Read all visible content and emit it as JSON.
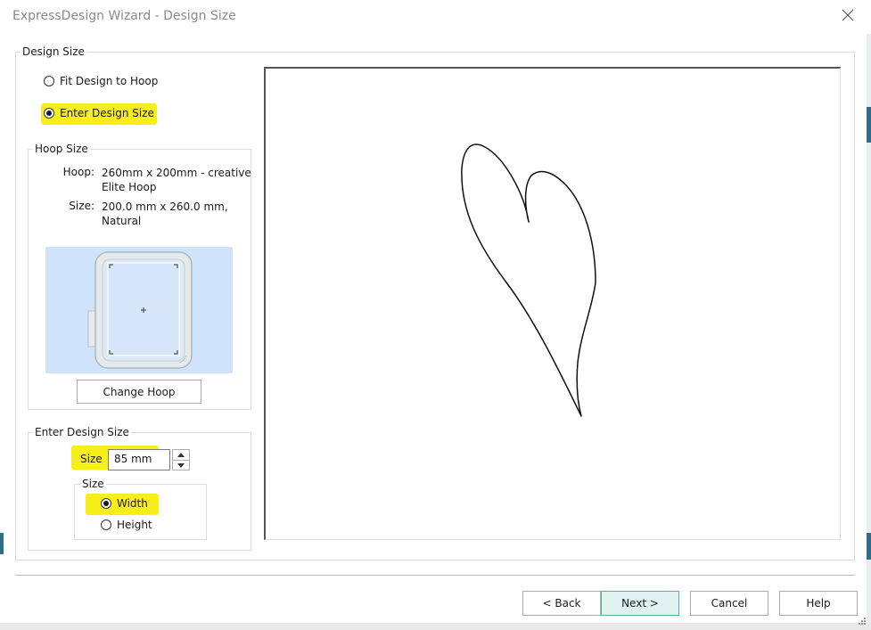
{
  "window": {
    "title": "ExpressDesign Wizard - Design Size",
    "close_icon": "close-icon"
  },
  "design_size_group": {
    "legend": "Design Size",
    "options": [
      {
        "label": "Fit Design to Hoop",
        "selected": false
      },
      {
        "label": "Enter Design Size",
        "selected": true
      }
    ]
  },
  "hoop_size": {
    "legend": "Hoop Size",
    "hoop_label": "Hoop:",
    "hoop_value": "260mm x 200mm - creative Elite Hoop",
    "size_label": "Size:",
    "size_value": "200.0 mm x 260.0 mm, Natural",
    "change_button": "Change Hoop"
  },
  "enter_design_size": {
    "legend": "Enter Design Size",
    "size_label": "Size",
    "size_value": "85 mm",
    "orientation": {
      "legend": "Size",
      "options": [
        {
          "label": "Width",
          "selected": true
        },
        {
          "label": "Height",
          "selected": false
        }
      ]
    }
  },
  "buttons": {
    "back": "< Back",
    "next": "Next >",
    "cancel": "Cancel",
    "help": "Help"
  },
  "colors": {
    "highlight": "#f8ef1a",
    "next_button_bg": "#dff2ef",
    "next_button_border": "#56b3a6",
    "hoop_bg": "#cfe4fb",
    "accent_strip": "#2f6f86"
  }
}
